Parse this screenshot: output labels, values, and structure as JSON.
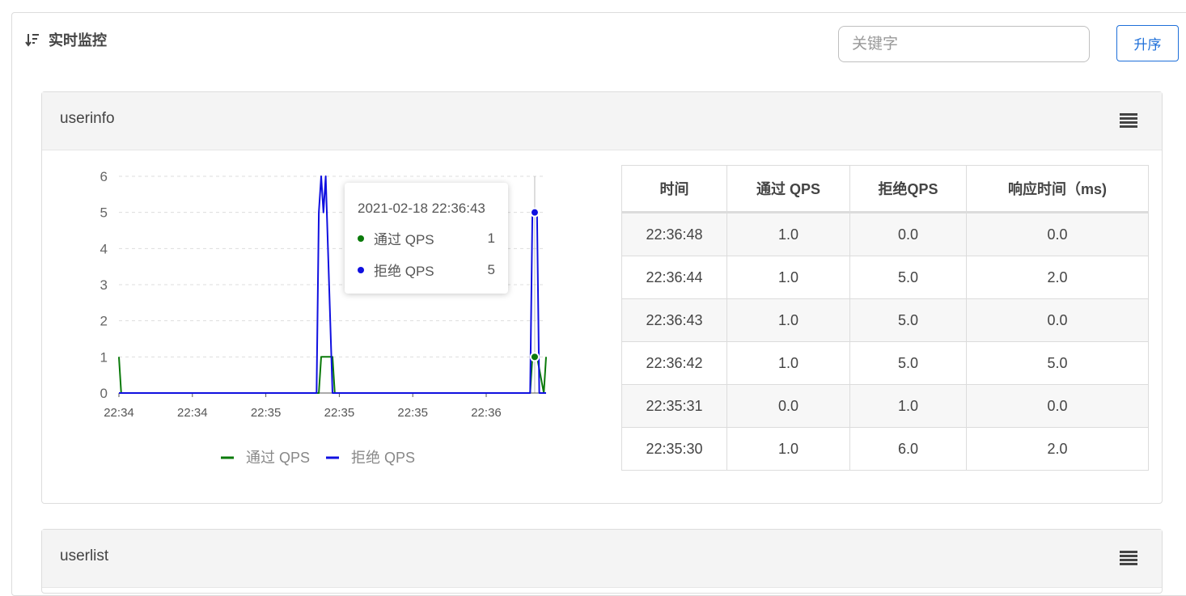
{
  "header": {
    "title": "实时监控",
    "sort_icon": "sort-icon"
  },
  "search": {
    "placeholder": "关键字",
    "value": ""
  },
  "sort_button": {
    "label": "升序"
  },
  "colors": {
    "pass": "#0a7a0a",
    "block": "#1010e0",
    "accent": "#1e6fd9"
  },
  "resources": [
    {
      "name": "userinfo",
      "menu_icon": "menu-icon",
      "legend": [
        {
          "label": "通过 QPS",
          "color": "#0a7a0a"
        },
        {
          "label": "拒绝 QPS",
          "color": "#1010e0"
        }
      ],
      "tooltip": {
        "time": "2021-02-18 22:36:43",
        "rows": [
          {
            "label": "通过 QPS",
            "value": "1"
          },
          {
            "label": "拒绝 QPS",
            "value": "5"
          }
        ]
      },
      "table": {
        "columns": [
          "时间",
          "通过 QPS",
          "拒绝QPS",
          "响应时间（ms)"
        ],
        "rows": [
          [
            "22:36:48",
            "1.0",
            "0.0",
            "0.0"
          ],
          [
            "22:36:44",
            "1.0",
            "5.0",
            "2.0"
          ],
          [
            "22:36:43",
            "1.0",
            "5.0",
            "0.0"
          ],
          [
            "22:36:42",
            "1.0",
            "5.0",
            "5.0"
          ],
          [
            "22:35:31",
            "0.0",
            "1.0",
            "0.0"
          ],
          [
            "22:35:30",
            "1.0",
            "6.0",
            "2.0"
          ]
        ]
      }
    },
    {
      "name": "userlist",
      "menu_icon": "menu-icon"
    }
  ],
  "chart_data": {
    "type": "line",
    "title": "",
    "xlabel": "",
    "ylabel": "",
    "x_tick_labels": [
      "22:34",
      "22:34",
      "22:35",
      "22:35",
      "22:35",
      "22:36"
    ],
    "ylim": [
      0,
      6
    ],
    "y_ticks": [
      0,
      1,
      2,
      3,
      4,
      5,
      6
    ],
    "grid": "dashed horizontal",
    "legend_position": "bottom",
    "series": [
      {
        "name": "通过 QPS",
        "color": "#0a7a0a",
        "x": [
          "22:33:40",
          "22:33:41",
          "22:35:08",
          "22:35:09",
          "22:35:14",
          "22:35:15",
          "22:36:41",
          "22:36:42",
          "22:36:43",
          "22:36:44",
          "22:36:47",
          "22:36:48"
        ],
        "y": [
          1,
          0,
          0,
          1,
          1,
          0,
          0,
          1,
          1,
          1,
          0,
          1
        ]
      },
      {
        "name": "拒绝 QPS",
        "color": "#1010e0",
        "x": [
          "22:33:40",
          "22:35:07",
          "22:35:08",
          "22:35:09",
          "22:35:10",
          "22:35:11",
          "22:35:14",
          "22:36:41",
          "22:36:42",
          "22:36:43",
          "22:36:44",
          "22:36:45",
          "22:36:48"
        ],
        "y": [
          0,
          0,
          5,
          6,
          5,
          6,
          0,
          0,
          5,
          5,
          5,
          0,
          0
        ]
      }
    ],
    "highlight": {
      "x": "22:36:43",
      "values": [
        1,
        5
      ]
    }
  }
}
